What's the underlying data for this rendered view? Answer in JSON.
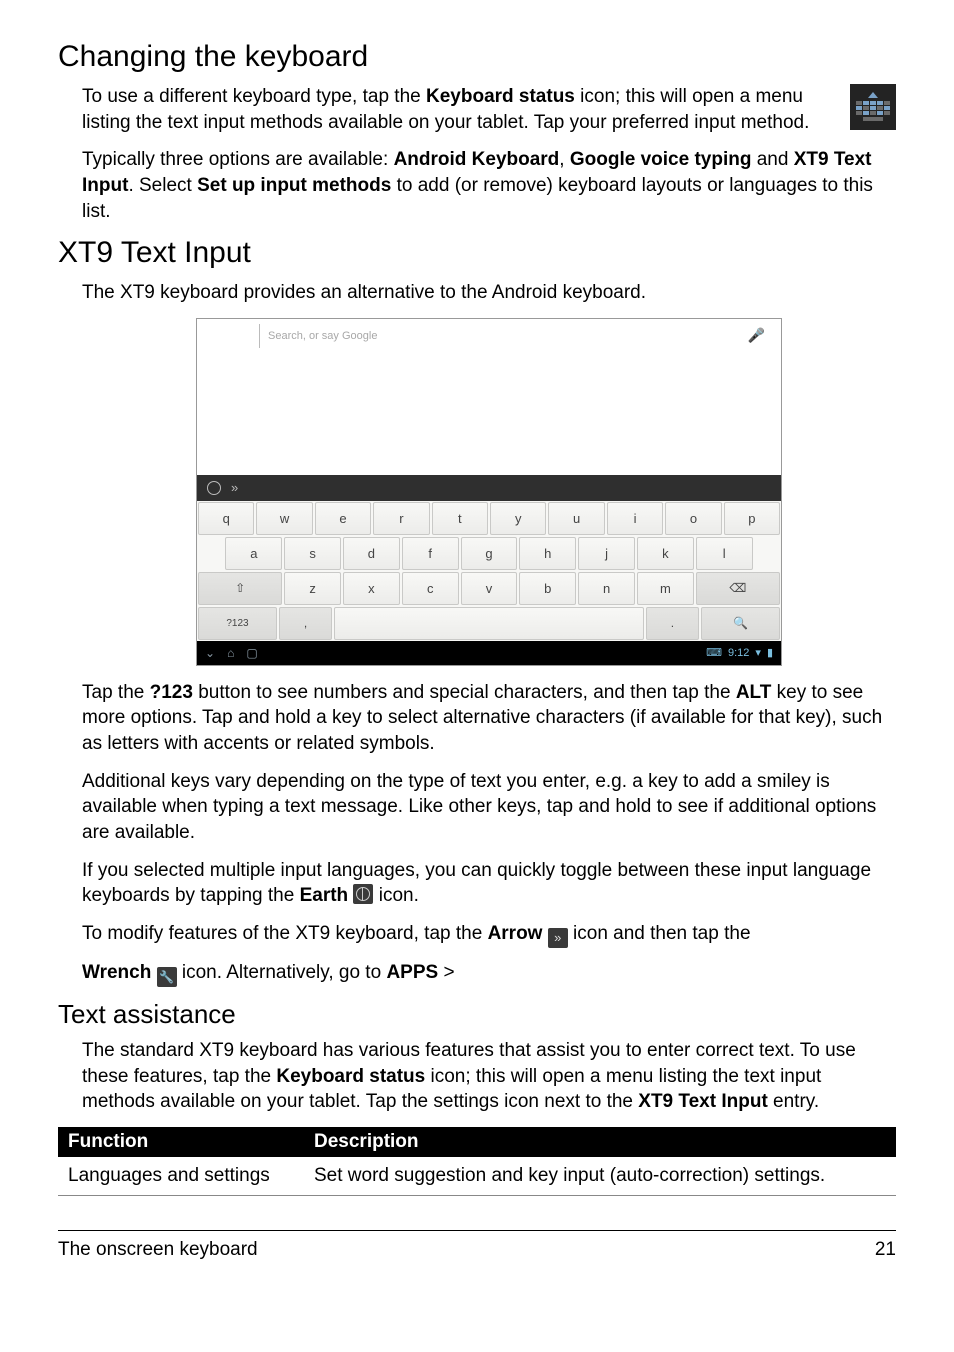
{
  "sections": {
    "changing_h": "Changing the keyboard",
    "changing_p1_a": "To use a different keyboard type, tap the ",
    "changing_p1_b": " icon; this will open a menu listing the text input methods available on your tablet. Tap your preferred input method.",
    "kbd_status_bold": "Keyboard status",
    "changing_p2_a": "Typically three options are available: ",
    "changing_p2_b": ", ",
    "changing_p2_c": " and ",
    "changing_p2_d": ". Select ",
    "changing_p2_e": " to add (or remove) keyboard layouts or languages to this list.",
    "android_kbd_bold": "Android Keyboard",
    "gvt_bold": "Google voice typing",
    "xt9_bold": "XT9 Text Input",
    "setup_bold": "Set up input methods",
    "xt9_h": "XT9 Text Input",
    "xt9_intro": "The XT9 keyboard provides an alternative to the Android keyboard.",
    "xt9_p1_a": "Tap the ",
    "xt9_p1_b": " button to see numbers and special characters, and then tap the ",
    "xt9_p1_c": " key to see more options. Tap and hold a key to select alternative characters (if available for that key), such as letters with accents or related symbols.",
    "q123_bold": "?123",
    "alt_bold": "ALT",
    "xt9_p2": "Additional keys vary depending on the type of text you enter, e.g. a key to add a smiley is available when typing a text message. Like other keys, tap and hold to see if additional options are available.",
    "xt9_p3_a": "If you selected multiple input languages, you can quickly toggle between these input language keyboards by tapping the ",
    "xt9_p3_b": " icon.",
    "earth_bold": "Earth ",
    "xt9_p4_a": "To modify features of the XT9 keyboard, tap the ",
    "xt9_p4_b": " icon and then tap the ",
    "arrow_bold": "Arrow ",
    "xt9_p5_a": " icon. Alternatively, go to ",
    "xt9_p5_b": " >",
    "wrench_bold": "Wrench ",
    "apps_bold": "APPS",
    "text_assist_h": "Text assistance",
    "text_assist_p_a": "The standard XT9 keyboard has various features that assist you to enter correct text. To use these features, tap the ",
    "text_assist_p_b": " icon; this will open a menu listing the text input methods available on your tablet. Tap the settings icon next to the ",
    "text_assist_p_c": " entry.",
    "tbl_h1": "Function",
    "tbl_h2": "Description",
    "tbl_r1c1": "Languages and settings",
    "tbl_r1c2": "Set word suggestion and key input (auto-correction) settings."
  },
  "shot": {
    "search_ph": "Search, or say Google",
    "row1": [
      "q",
      "w",
      "e",
      "r",
      "t",
      "y",
      "u",
      "i",
      "o",
      "p"
    ],
    "row2": [
      "a",
      "s",
      "d",
      "f",
      "g",
      "h",
      "j",
      "k",
      "l"
    ],
    "row3_shift": "⇧",
    "row3": [
      "z",
      "x",
      "c",
      "v",
      "b",
      "n",
      "m"
    ],
    "row3_back": "⌫",
    "row4_sym": "?123",
    "row4_comma": ",",
    "row4_period": ".",
    "row4_search": "🔍",
    "nav_time": "9:12",
    "toolbar_chev": "»"
  },
  "footer": {
    "left": "The onscreen keyboard",
    "right": "21"
  }
}
